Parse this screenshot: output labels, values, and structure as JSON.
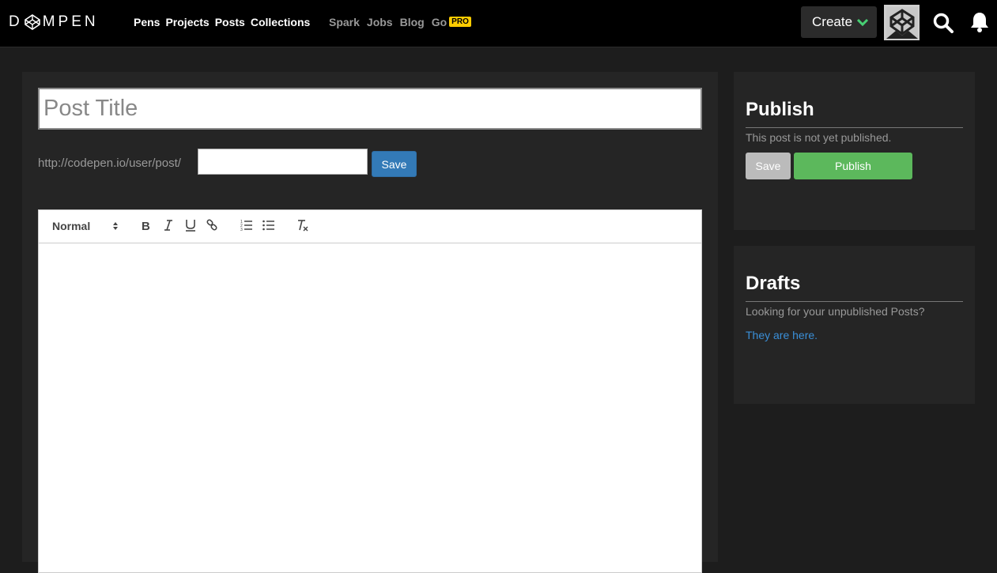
{
  "header": {
    "logo_text_left": "D",
    "logo_text_right": "MPEN",
    "main_nav": [
      "Pens",
      "Projects",
      "Posts",
      "Collections"
    ],
    "sub_nav": [
      "Spark",
      "Jobs",
      "Blog",
      "Go"
    ],
    "pro_badge": "PRO",
    "create_label": "Create"
  },
  "editor": {
    "title_placeholder": "Post Title",
    "url_prefix": "http://codepen.io/user/post/",
    "slug_value": "",
    "save_label": "Save",
    "format_select": "Normal"
  },
  "publish": {
    "title": "Publish",
    "status": "This post is not yet published.",
    "save_label": "Save",
    "publish_label": "Publish"
  },
  "drafts": {
    "title": "Drafts",
    "prompt": "Looking for your unpublished Posts?",
    "link": "They are here."
  },
  "colors": {
    "accent_blue": "#337ab7",
    "publish_green": "#5cb85c",
    "pro_yellow": "#ffcc00",
    "link_blue": "#3a8fd8"
  }
}
